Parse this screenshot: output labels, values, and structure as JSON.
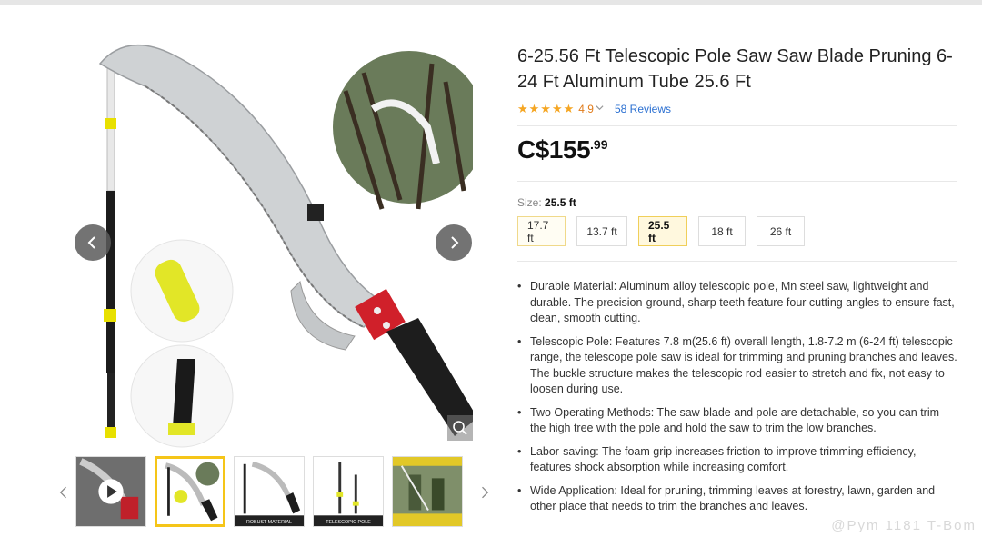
{
  "product": {
    "title": "6-25.56 Ft Telescopic Pole Saw Saw Blade Pruning 6-24 Ft Aluminum Tube 25.6 Ft",
    "stars": "★★★★★",
    "rating": "4.9",
    "reviews_link": "58 Reviews",
    "price_main": "C$155",
    "price_cents": ".99"
  },
  "size": {
    "label": "Size:",
    "selected_value": "25.5 ft",
    "options": [
      "17.7 ft",
      "13.7 ft",
      "25.5 ft",
      "18 ft",
      "26 ft"
    ]
  },
  "features": [
    "Durable Material: Aluminum alloy telescopic pole, Mn steel saw, lightweight and durable. The precision-ground, sharp teeth feature four cutting angles to ensure fast, clean, smooth cutting.",
    "Telescopic Pole: Features 7.8 m(25.6 ft) overall length, 1.8-7.2 m (6-24 ft) telescopic range, the telescope pole saw is ideal for trimming and pruning branches and leaves. The buckle structure makes the telescopic rod easier to stretch and fix, not easy to loosen during use.",
    "Two Operating Methods: The saw blade and pole are detachable, so you can trim the high tree with the pole and hold the saw to trim the low branches.",
    "Labor-saving: The foam grip increases friction to improve trimming efficiency, features shock absorption while increasing comfort.",
    "Wide Application: Ideal for pruning, trimming leaves at forestry, lawn, garden and other place that needs to trim the branches and leaves."
  ],
  "thumbnails": {
    "captions": [
      "",
      "",
      "ROBUST MATERIAL",
      "TELESCOPIC POLE",
      ""
    ]
  },
  "icons": {
    "prev": "chevron-left-icon",
    "next": "chevron-right-icon",
    "zoom": "magnifier-icon",
    "play": "play-icon"
  },
  "colors": {
    "accent_yellow": "#f5c518",
    "price": "#111111",
    "rating": "#e07b1a",
    "link": "#2a6fd1"
  },
  "watermark": "@Pym 1181 T-Bom"
}
